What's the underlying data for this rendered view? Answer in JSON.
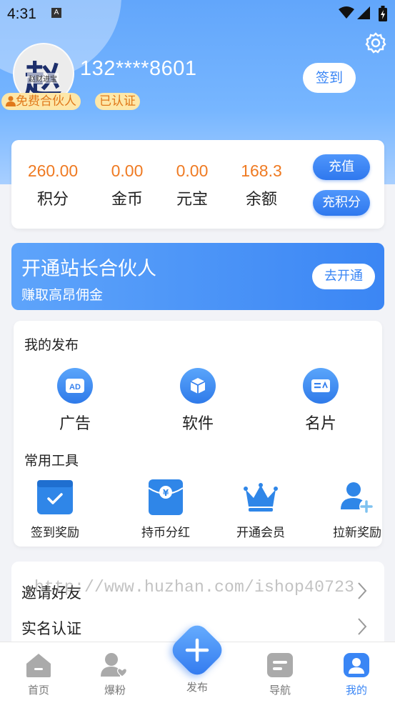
{
  "status_bar": {
    "time": "4:31",
    "notif_letter": "A"
  },
  "profile": {
    "avatar_char": "赵",
    "avatar_sub": "赵财进宝",
    "phone": "132****8601",
    "badge_partner": "免费合伙人",
    "badge_verified": "已认证",
    "signin_label": "签到"
  },
  "wallet": {
    "stats": [
      {
        "value": "260.00",
        "label": "积分"
      },
      {
        "value": "0.00",
        "label": "金币"
      },
      {
        "value": "0.00",
        "label": "元宝"
      },
      {
        "value": "168.3",
        "label": "余额"
      }
    ],
    "recharge_label": "充值",
    "recharge_points_label": "充积分"
  },
  "promo": {
    "title": "开通站长合伙人",
    "subtitle": "赚取高昂佣金",
    "button_label": "去开通"
  },
  "my_publish": {
    "heading": "我的发布",
    "items": [
      {
        "label": "广告",
        "icon": "ad-icon"
      },
      {
        "label": "软件",
        "icon": "box-icon"
      },
      {
        "label": "名片",
        "icon": "card-icon"
      }
    ]
  },
  "tools": {
    "heading": "常用工具",
    "items": [
      {
        "label": "签到奖励",
        "icon": "calendar-check-icon"
      },
      {
        "label": "持币分红",
        "icon": "envelope-yen-icon"
      },
      {
        "label": "开通会员",
        "icon": "crown-icon"
      },
      {
        "label": "拉新奖励",
        "icon": "add-user-icon"
      }
    ]
  },
  "list": {
    "rows": [
      {
        "label": "邀请好友"
      },
      {
        "label": "实名认证"
      }
    ]
  },
  "watermark": "http://www.huzhan.com/ishop40723",
  "tabbar": {
    "tabs": [
      {
        "label": "首页",
        "icon": "home-icon"
      },
      {
        "label": "爆粉",
        "icon": "user-heart-icon"
      },
      {
        "label": "发布",
        "icon": "plus-icon"
      },
      {
        "label": "导航",
        "icon": "nav-icon"
      },
      {
        "label": "我的",
        "icon": "profile-icon"
      }
    ],
    "active": "我的"
  },
  "colors": {
    "accent": "#3a86f5",
    "value_orange": "#ef7a22",
    "badge_bg": "#fde7a8",
    "header_blue": "#62a6fb"
  }
}
